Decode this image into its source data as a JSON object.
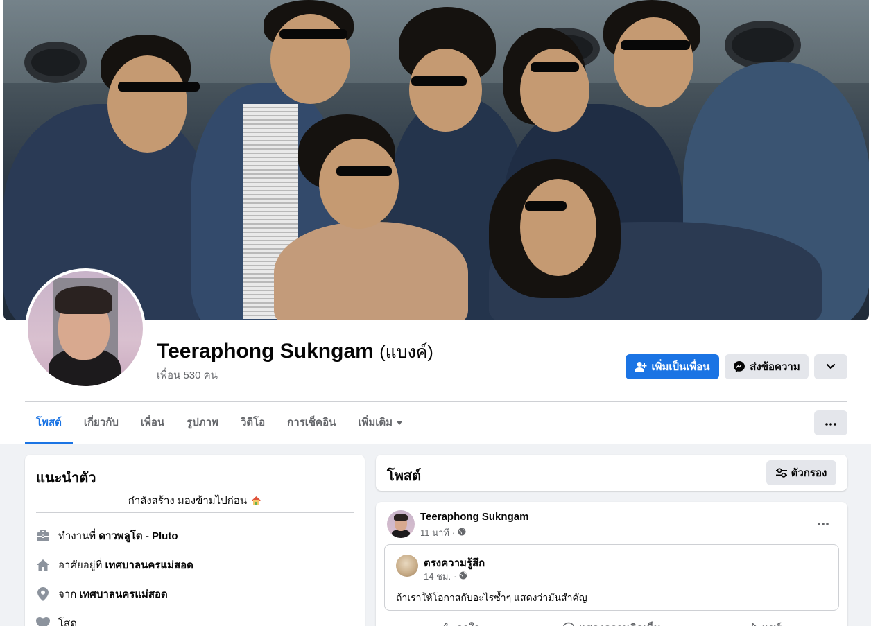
{
  "profile": {
    "name": "Teeraphong Sukngam",
    "nickname": "(แบงค์)",
    "friends_count": "เพื่อน 530 คน"
  },
  "actions": {
    "add_friend": "เพิ่มเป็นเพื่อน",
    "message": "ส่งข้อความ"
  },
  "tabs": [
    {
      "label": "โพสต์"
    },
    {
      "label": "เกี่ยวกับ"
    },
    {
      "label": "เพื่อน"
    },
    {
      "label": "รูปภาพ"
    },
    {
      "label": "วิดีโอ"
    },
    {
      "label": "การเช็คอิน"
    },
    {
      "label": "เพิ่มเติม"
    }
  ],
  "intro": {
    "title": "แนะนำตัว",
    "bio": "กำลังสร้าง มองข้ามไปก่อน",
    "work_prefix": "ทำงานที่",
    "work_place": "ดาวพลูโต - Pluto",
    "lives_prefix": "อาศัยอยู่ที่",
    "lives_place": "เทศบาลนครแม่สอด",
    "from_prefix": "จาก",
    "from_place": "เทศบาลนครแม่สอด",
    "relationship": "โสด"
  },
  "posts_header": {
    "title": "โพสต์",
    "filter_label": "ตัวกรอง"
  },
  "post": {
    "author": "Teeraphong Sukngam",
    "time": "11 นาที",
    "shared": {
      "author": "ตรงความรู้สึก",
      "time": "14 ชม.",
      "text": "ถ้าเราให้โอกาสกับอะไรซ้ำๆ แสดงว่ามันสำคัญ"
    },
    "like_label": "ถูกใจ",
    "comment_label": "แสดงความคิดเห็น",
    "share_label": "แชร์"
  },
  "colors": {
    "primary": "#1b74e4",
    "secondary_button": "#e4e6eb",
    "page_bg": "#f0f2f5",
    "muted_text": "#65676b"
  },
  "icons": {
    "add_friend": "user-plus-icon",
    "message": "messenger-icon",
    "more": "chevron-down-icon",
    "work": "briefcase-icon",
    "home": "house-icon",
    "location": "map-pin-icon",
    "relationship": "heart-icon",
    "bio_emoji": "house-emoji-icon",
    "privacy": "globe-icon",
    "filter": "sliders-icon"
  }
}
